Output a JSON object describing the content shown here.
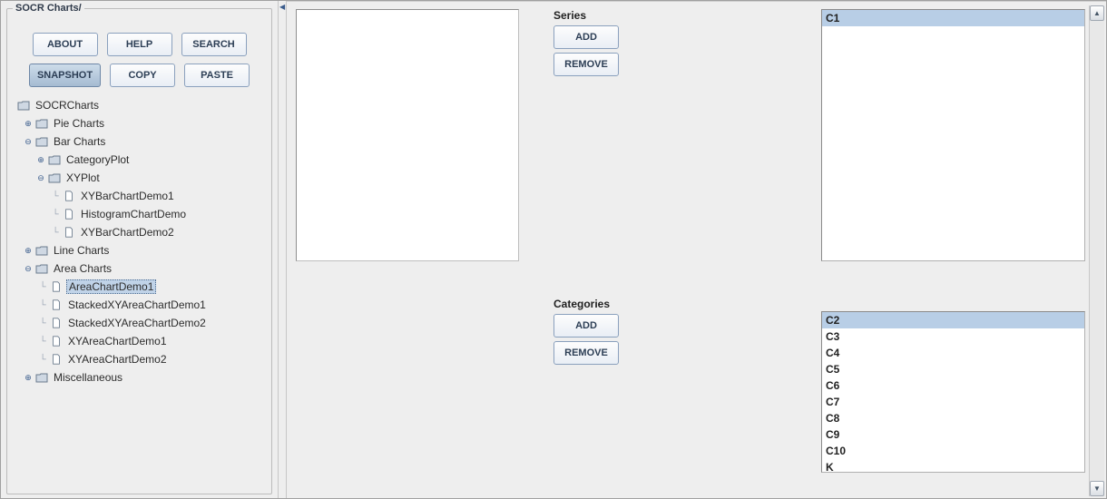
{
  "sidebar": {
    "legend": "SOCR Charts/",
    "buttons_row1": {
      "about": "ABOUT",
      "help": "HELP",
      "search": "SEARCH"
    },
    "buttons_row2": {
      "snapshot": "SNAPSHOT",
      "copy": "COPY",
      "paste": "PASTE"
    }
  },
  "tree": {
    "root": "SOCRCharts",
    "pie": "Pie Charts",
    "bar": "Bar Charts",
    "categoryplot": "CategoryPlot",
    "xyplot": "XYPlot",
    "xybar1": "XYBarChartDemo1",
    "histogram": "HistogramChartDemo",
    "xybar2": "XYBarChartDemo2",
    "line": "Line Charts",
    "area": "Area Charts",
    "areademo1": "AreaChartDemo1",
    "stackedxy1": "StackedXYAreaChartDemo1",
    "stackedxy2": "StackedXYAreaChartDemo2",
    "xyarea1": "XYAreaChartDemo1",
    "xyarea2": "XYAreaChartDemo2",
    "misc": "Miscellaneous"
  },
  "series": {
    "title": "Series",
    "add": "ADD",
    "remove": "REMOVE",
    "items": {
      "c1": "C1"
    }
  },
  "categories": {
    "title": "Categories",
    "add": "ADD",
    "remove": "REMOVE",
    "items": {
      "c2": "C2",
      "c3": "C3",
      "c4": "C4",
      "c5": "C5",
      "c6": "C6",
      "c7": "C7",
      "c8": "C8",
      "c9": "C9",
      "c10": "C10",
      "k": "K"
    }
  }
}
